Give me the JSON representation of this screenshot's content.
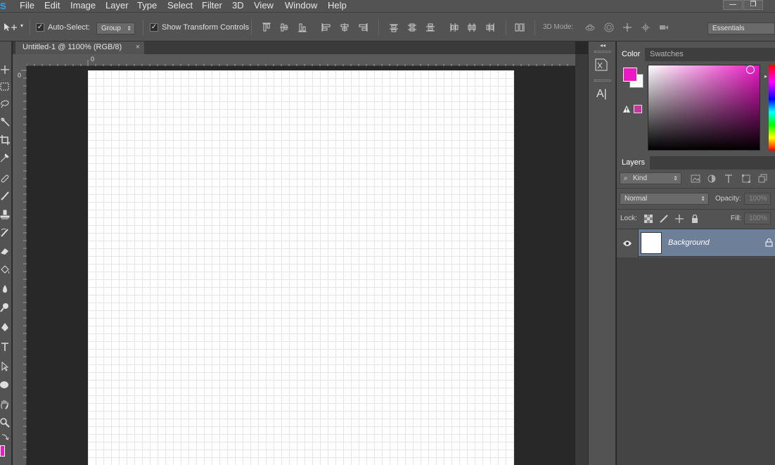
{
  "app": {
    "logo_letter": "S"
  },
  "menu": [
    "File",
    "Edit",
    "Image",
    "Layer",
    "Type",
    "Select",
    "Filter",
    "3D",
    "View",
    "Window",
    "Help"
  ],
  "window_controls": {
    "minimize": "—",
    "restore": "❐"
  },
  "options_bar": {
    "auto_select_label": "Auto-Select:",
    "auto_select_checked": true,
    "auto_select_mode": "Group",
    "show_transform_label": "Show Transform Controls",
    "show_transform_checked": true,
    "mode_3d_label": "3D Mode:",
    "workspace": "Essentials"
  },
  "document": {
    "tab_title": "Untitled-1 @ 1100% (RGB/8)",
    "close": "×",
    "ruler_origin_h": "0",
    "ruler_origin_v": "0"
  },
  "colors": {
    "foreground": "#ec18c6",
    "background": "#ffffff",
    "accent": "#2fa3e6"
  },
  "color_panel": {
    "tabs": [
      "Color",
      "Swatches"
    ],
    "active_tab": "Color"
  },
  "layers_panel": {
    "tab": "Layers",
    "filter_kind": "Kind",
    "blend_mode": "Normal",
    "opacity_label": "Opacity:",
    "opacity_value": "100%",
    "lock_label": "Lock:",
    "fill_label": "Fill:",
    "fill_value": "100%",
    "layers": [
      {
        "name": "Background",
        "visible": true,
        "locked": true
      }
    ]
  },
  "dock": {
    "char_panel_label": "A|"
  }
}
